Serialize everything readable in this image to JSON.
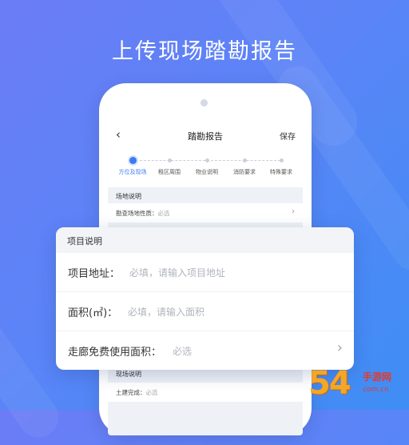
{
  "headline": "上传现场踏勘报告",
  "phone_screen": {
    "back_icon": "chevron-left-icon",
    "title": "踏勘报告",
    "save_label": "保存",
    "steps": [
      {
        "label": "方位及现场",
        "active": true
      },
      {
        "label": "租区周围",
        "active": false
      },
      {
        "label": "物业说明",
        "active": false
      },
      {
        "label": "消防要求",
        "active": false
      },
      {
        "label": "特殊要求",
        "active": false
      }
    ],
    "site_section_title": "场地说明",
    "site_nature_label": "勘查场地性质：",
    "site_nature_value": "必选",
    "scene_section_title": "现场说明",
    "civil_done_label": "土建完成：",
    "civil_done_value": "必选"
  },
  "project_card": {
    "title": "项目说明",
    "address_label": "项目地址：",
    "address_placeholder": "必填，请输入项目地址",
    "area_label": "面积(㎡)：",
    "area_placeholder": "必填，请输入面积",
    "corridor_label": "走廊免费使用面积：",
    "corridor_value": "必选"
  },
  "watermark": {
    "number": "54",
    "text": "手游网",
    "domain": "com.cn"
  },
  "colors": {
    "accent": "#3a7bf5",
    "watermark": "#f5a623"
  }
}
